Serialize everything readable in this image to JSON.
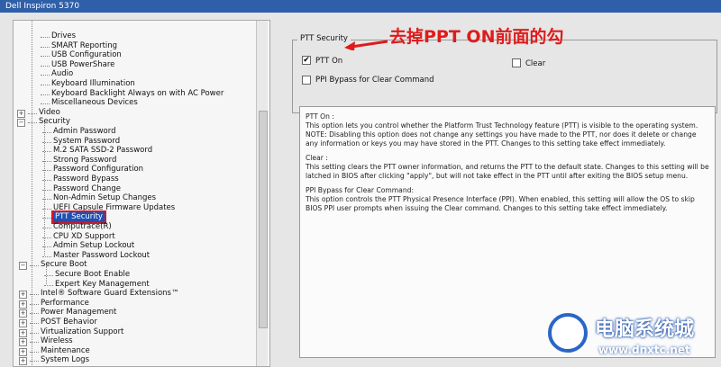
{
  "window": {
    "title": "Dell Inspiron 5370"
  },
  "tree": {
    "settings_children_top": [
      "Drives",
      "SMART Reporting",
      "USB Configuration",
      "USB PowerShare",
      "Audio",
      "Keyboard Illumination",
      "Keyboard Backlight Always on with AC Power",
      "Miscellaneous Devices"
    ],
    "video": "Video",
    "security": "Security",
    "security_children": [
      "Admin Password",
      "System Password",
      "M.2 SATA SSD-2 Password",
      "Strong Password",
      "Password Configuration",
      "Password Bypass",
      "Password Change",
      "Non-Admin Setup Changes",
      "UEFI Capsule Firmware Updates",
      "PTT Security",
      "Computrace(R)",
      "CPU XD Support",
      "Admin Setup Lockout",
      "Master Password Lockout"
    ],
    "secure_boot": "Secure Boot",
    "secure_boot_children": [
      "Secure Boot Enable",
      "Expert Key Management"
    ],
    "bottom_groups": [
      "Intel® Software Guard Extensions™",
      "Performance",
      "Power Management",
      "POST Behavior",
      "Virtualization Support",
      "Wireless",
      "Maintenance",
      "System Logs"
    ],
    "selected": "PTT Security"
  },
  "ptt": {
    "group_title": "PTT Security",
    "ptt_on_label": "PTT On",
    "ptt_on_checked": true,
    "clear_label": "Clear",
    "clear_checked": false,
    "ppi_label": "PPI Bypass for Clear Command",
    "ppi_checked": false
  },
  "description": {
    "p1_title": "PTT On :",
    "p1_text": "This option lets you control whether the Platform Trust Technology feature (PTT) is visible to the operating system.",
    "p1_note": "NOTE: Disabling this option does not change any settings you have made to the PTT, nor does it delete or change any information or keys you may have stored in the PTT. Changes to this setting take effect immediately.",
    "p2_title": "Clear :",
    "p2_text": "This setting clears the PTT owner information, and returns the PTT to the default state. Changes to this setting will be latched in BIOS after clicking \"apply\", but will not take effect in the PTT until after exiting the BIOS setup menu.",
    "p3_title": "PPI Bypass for Clear Command:",
    "p3_text": "This option controls the PTT Physical Presence Interface (PPI). When enabled, this setting will allow the OS to skip BIOS PPI user prompts when issuing the Clear command. Changes to this setting take effect immediately."
  },
  "annotation": {
    "text": "去掉PPT ON前面的勾",
    "color": "#e01b1b"
  },
  "watermark": {
    "brand": "电脑系统城",
    "url": "www.dnxtc.net"
  },
  "colors": {
    "title_bar": "#2f5fa8",
    "selection": "#1e50b4",
    "highlight_box": "#d0182a"
  }
}
